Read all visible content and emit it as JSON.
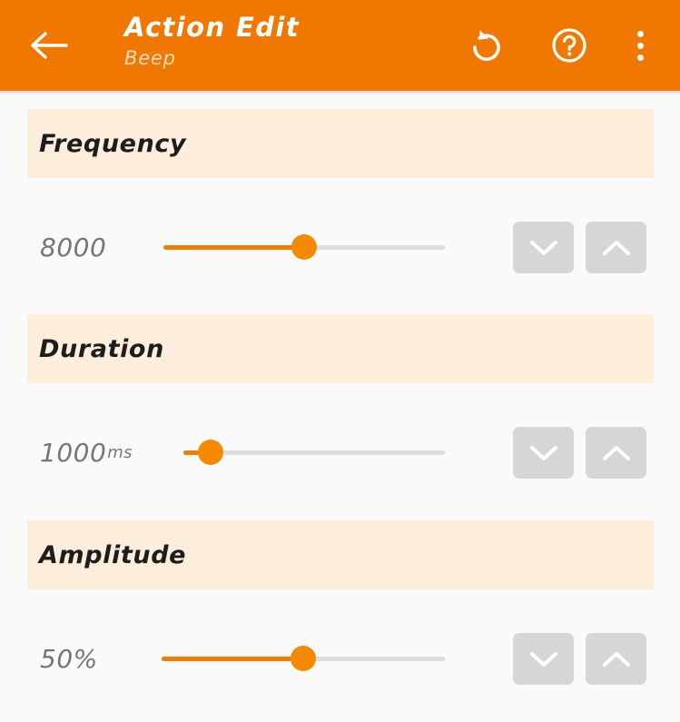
{
  "appbar": {
    "title": "Action Edit",
    "subtitle": "Beep",
    "back_icon": "arrow-left-icon",
    "undo_icon": "undo-icon",
    "help_icon": "help-circle-icon",
    "more_icon": "overflow-menu-icon",
    "background_color": "#f07800",
    "title_color": "#ffffff",
    "subtitle_color": "#fbdcbe"
  },
  "theme": {
    "accent": "#ef7d00",
    "band_background": "#fdeedc",
    "page_background": "#fafafa",
    "track_color": "#dddddd",
    "stepper_background": "#d6d6d6",
    "value_color": "#767676"
  },
  "sections": [
    {
      "label": "Frequency",
      "value": "8000",
      "unit": "",
      "slider_percent": 50,
      "decrement_label": "chevron-down-icon",
      "increment_label": "chevron-up-icon"
    },
    {
      "label": "Duration",
      "value": "1000",
      "unit": "ms",
      "slider_percent": 10,
      "decrement_label": "chevron-down-icon",
      "increment_label": "chevron-up-icon"
    },
    {
      "label": "Amplitude",
      "value": "50%",
      "unit": "",
      "slider_percent": 50,
      "decrement_label": "chevron-down-icon",
      "increment_label": "chevron-up-icon"
    }
  ]
}
